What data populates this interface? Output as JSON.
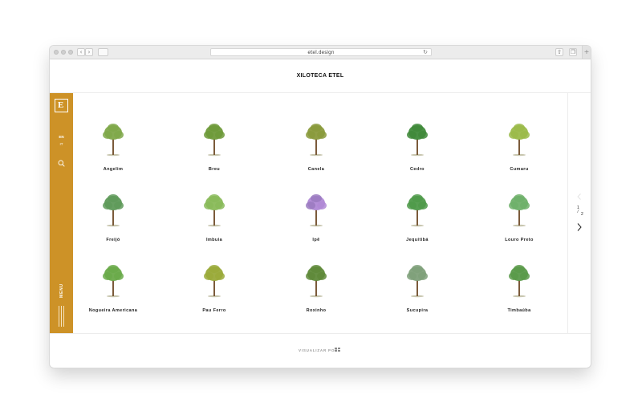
{
  "browser": {
    "url": "etel.design"
  },
  "site": {
    "title": "XILOTECA ETEL",
    "logo_glyph": "E"
  },
  "sidebar": {
    "lang_primary": "EN",
    "lang_secondary": "IT",
    "menu_label": "MENU",
    "accent_color": "#cd9227"
  },
  "trees": [
    {
      "name": "Angelim",
      "crown": "#7fa84a",
      "flower": ""
    },
    {
      "name": "Breu",
      "crown": "#6f9a3a",
      "flower": ""
    },
    {
      "name": "Canela",
      "crown": "#8a9a3c",
      "flower": ""
    },
    {
      "name": "Cedro",
      "crown": "#3f8a3a",
      "flower": ""
    },
    {
      "name": "Cumaru",
      "crown": "#9bbb4a",
      "flower": ""
    },
    {
      "name": "Freijó",
      "crown": "#5f9a5a",
      "flower": ""
    },
    {
      "name": "Imbuia",
      "crown": "#8abb5a",
      "flower": ""
    },
    {
      "name": "Ipê",
      "crown": "#9a7ac0",
      "flower": "#b089d6"
    },
    {
      "name": "Jequitibá",
      "crown": "#4f9a4a",
      "flower": ""
    },
    {
      "name": "Louro Preto",
      "crown": "#6fb06a",
      "flower": ""
    },
    {
      "name": "Nogueira Americana",
      "crown": "#6aaa4a",
      "flower": ""
    },
    {
      "name": "Pau Ferro",
      "crown": "#9aaa3a",
      "flower": ""
    },
    {
      "name": "Roxinho",
      "crown": "#5f8a3a",
      "flower": ""
    },
    {
      "name": "Sucupira",
      "crown": "#7fa07a",
      "flower": ""
    },
    {
      "name": "Timbaúba",
      "crown": "#5a9a4a",
      "flower": ""
    }
  ],
  "pagination": {
    "current": "1",
    "total": "2"
  },
  "footer": {
    "view_label": "VISUALIZAR POR:"
  }
}
